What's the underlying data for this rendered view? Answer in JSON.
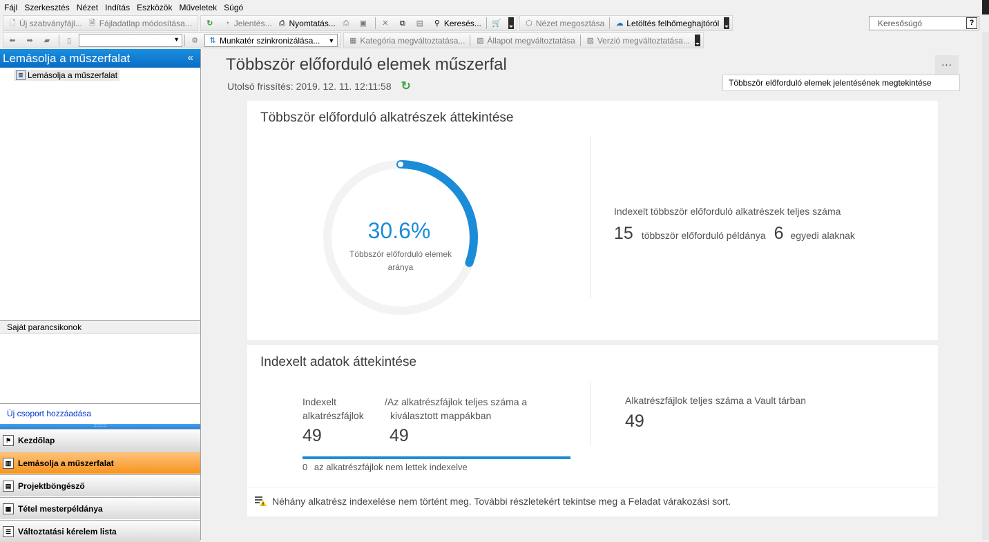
{
  "menu": [
    "Fájl",
    "Szerkesztés",
    "Nézet",
    "Indítás",
    "Eszközök",
    "Műveletek",
    "Súgó"
  ],
  "toolbar1": {
    "new_std_file": "Új szabványfájl...",
    "edit_datasheet": "Fájladatlap módosítása...",
    "reports": "Jelentés...",
    "print": "Nyomtatás...",
    "search": "Keresés...",
    "share_view": "Nézet megosztása",
    "download_cloud": "Letöltés felhőmeghajtóról"
  },
  "search_help": {
    "placeholder": "Keresősúgó",
    "help": "?"
  },
  "toolbar2": {
    "workspace_sync": "Munkatér szinkronizálása...",
    "change_category": "Kategória megváltoztatása...",
    "change_state": "Állapot megváltoztatása",
    "change_revision": "Verzió megváltoztatása..."
  },
  "left_panel": {
    "title": "Lemásolja a műszerfalat",
    "collapse": "«",
    "tree_item": "Lemásolja a műszerfalat",
    "my_commands": "Saját parancsikonok",
    "add_group": "Új csoport hozzáadása",
    "grip": "::::::::::",
    "nav": [
      {
        "label": "Kezdőlap",
        "icon": "home-icon"
      },
      {
        "label": "Lemásolja a műszerfalat",
        "icon": "dashboard-icon"
      },
      {
        "label": "Projektböngésző",
        "icon": "project-icon"
      },
      {
        "label": "Tétel mesterpéldánya",
        "icon": "item-icon"
      },
      {
        "label": "Változtatási kérelem lista",
        "icon": "list-icon"
      }
    ]
  },
  "main": {
    "title": "Többször előforduló elemek műszerfal",
    "last_refresh": "Utolsó frissítés: 2019. 12. 11. 12:11:58",
    "more": "...",
    "tooltip": "Többször előforduló elemek jelentésének megtekintése"
  },
  "duplicates": {
    "title": "Többször előforduló alkatrészek áttekintése",
    "percent": "30.6%",
    "percent_value": 0.306,
    "ratio_label": "Többször előforduló elemek aránya",
    "total_label": "Indexelt többször előforduló alkatrészek teljes száma",
    "instances_count": "15",
    "instances_text": "többször előforduló példánya",
    "unique_count": "6",
    "unique_text": "egyedi alaknak"
  },
  "indexed": {
    "title": "Indexelt adatok áttekintése",
    "indexed_label_1": "Indexelt",
    "indexed_label_2": "alkatrészfájlok",
    "indexed_value": "49",
    "total_label_1": "/Az alkatrészfájlok teljes száma a",
    "total_label_2": "kiválasztott mappákban",
    "total_value": "49",
    "vault_label": "Alkatrészfájlok teljes száma a Vault tárban",
    "vault_value": "49",
    "not_indexed_count": "0",
    "not_indexed_text": "az alkatrészfájlok nem lettek indexelve",
    "indexed_fraction": 1.0
  },
  "warning": {
    "text": "Néhány alkatrész indexelése nem történt meg. További részletekért tekintse meg a Feladat várakozási sort."
  },
  "colors": {
    "accent": "#1a8cd8",
    "nav_active": "#f7941d",
    "header_blue": "#0a6cc4"
  }
}
